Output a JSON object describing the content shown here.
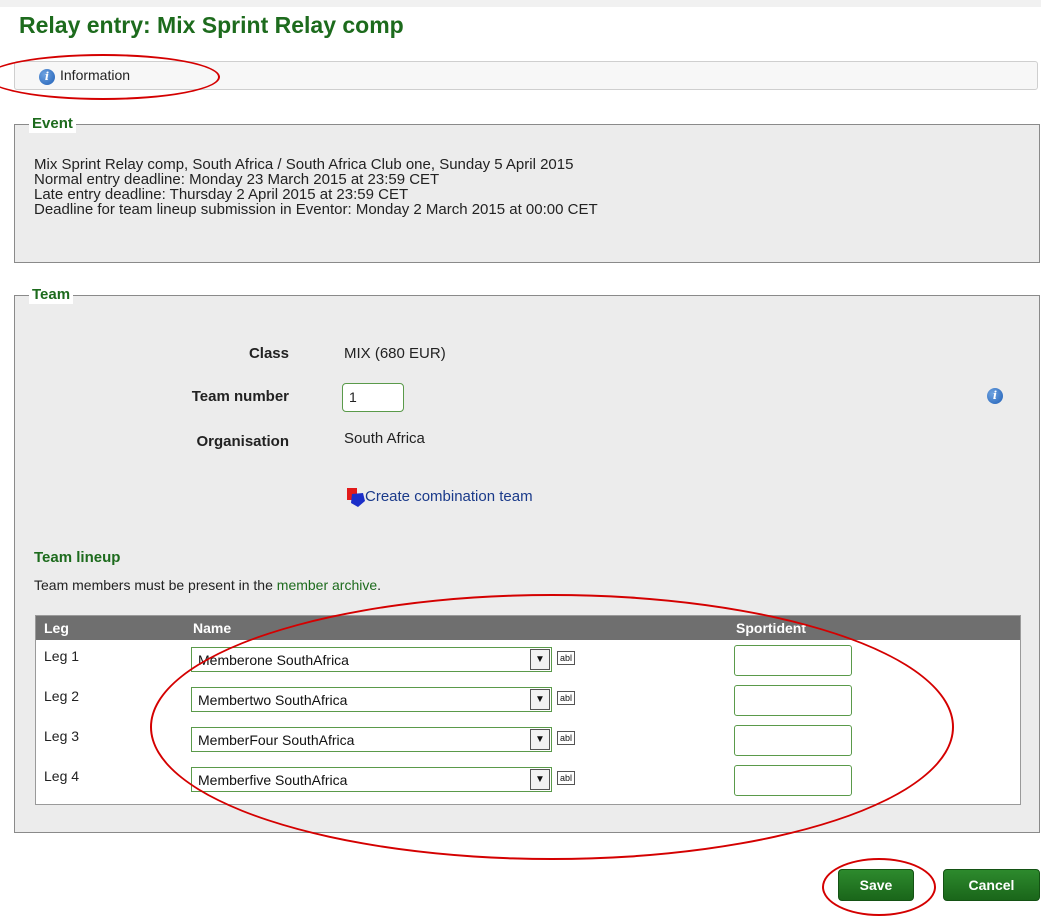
{
  "page": {
    "title": "Relay entry: Mix Sprint Relay comp"
  },
  "infobar": {
    "icon": "info-icon",
    "label": "Information"
  },
  "event": {
    "legend": "Event",
    "lines": [
      "Mix Sprint Relay comp, South Africa / South Africa Club one, Sunday 5 April 2015",
      "Normal entry deadline: Monday 23 March 2015 at 23:59 CET",
      "Late entry deadline: Thursday 2 April 2015 at 23:59 CET",
      "Deadline for team lineup submission in Eventor: Monday 2 March 2015 at 00:00 CET"
    ]
  },
  "team": {
    "legend": "Team",
    "class_label": "Class",
    "class_value": "MIX (680 EUR)",
    "team_number_label": "Team number",
    "team_number_value": "1",
    "organisation_label": "Organisation",
    "organisation_value": "South Africa",
    "combination_link": "Create combination team"
  },
  "lineup": {
    "heading": "Team lineup",
    "note_prefix": "Team members must be present in the ",
    "note_link": "member archive",
    "note_suffix": ".",
    "columns": [
      "Leg",
      "Name",
      "Sportident"
    ],
    "rows": [
      {
        "leg": "Leg 1",
        "name": "Memberone SouthAfrica",
        "sportident": ""
      },
      {
        "leg": "Leg 2",
        "name": "Membertwo SouthAfrica",
        "sportident": ""
      },
      {
        "leg": "Leg 3",
        "name": "MemberFour SouthAfrica",
        "sportident": ""
      },
      {
        "leg": "Leg 4",
        "name": "Memberfive SouthAfrica",
        "sportident": ""
      }
    ],
    "edit_glyph": "abl"
  },
  "buttons": {
    "save": "Save",
    "cancel": "Cancel"
  },
  "colors": {
    "heading_green": "#1d6b1d",
    "button_green": "#1a661a",
    "annotation_red": "#d40000",
    "table_header": "#6f6f6f"
  }
}
